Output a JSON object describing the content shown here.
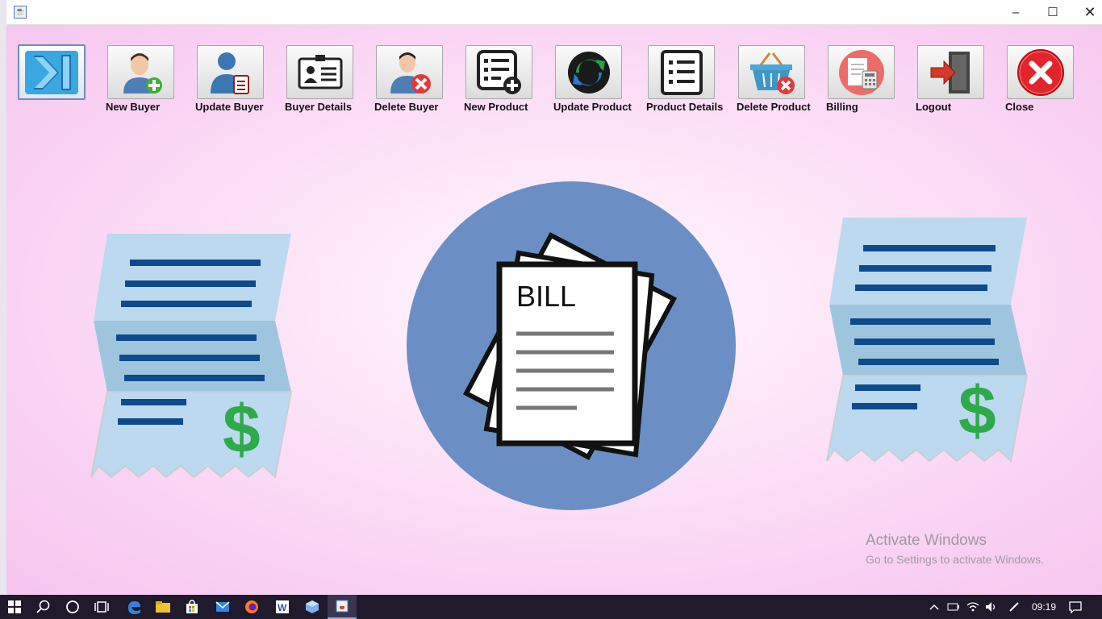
{
  "window": {
    "title_icon": "java-icon",
    "controls": {
      "minimize": "–",
      "maximize": "☐",
      "close": "✕"
    }
  },
  "toolbar": {
    "items": [
      {
        "label": "",
        "icon": "expand-sidebar-icon"
      },
      {
        "label": "New Buyer",
        "icon": "add-user-icon"
      },
      {
        "label": "Update Buyer",
        "icon": "edit-user-icon"
      },
      {
        "label": "Buyer Details",
        "icon": "id-card-icon"
      },
      {
        "label": "Delete Buyer",
        "icon": "delete-user-icon"
      },
      {
        "label": "New Product",
        "icon": "add-list-icon"
      },
      {
        "label": "Update Product",
        "icon": "refresh-icon"
      },
      {
        "label": "Product Details",
        "icon": "list-icon"
      },
      {
        "label": "Delete Product",
        "icon": "delete-basket-icon"
      },
      {
        "label": "Billing",
        "icon": "billing-icon"
      },
      {
        "label": "Logout",
        "icon": "logout-door-icon"
      },
      {
        "label": "Close",
        "icon": "close-circle-icon"
      }
    ]
  },
  "illustration": {
    "bill_text": "BILL",
    "currency_symbol": "$"
  },
  "watermark": {
    "title": "Activate Windows",
    "subtitle": "Go to Settings to activate Windows."
  },
  "taskbar": {
    "apps": [
      "windows-start-icon",
      "search-icon",
      "cortana-icon",
      "task-view-icon",
      "edge-icon",
      "file-explorer-icon",
      "store-icon",
      "mail-icon",
      "firefox-icon",
      "word-icon",
      "box-app-icon",
      "java-app-icon"
    ],
    "time": "09:19"
  },
  "colors": {
    "background": "#f9d0f3",
    "circle": "#6b8fc5",
    "receipt_light": "#bcd9ef",
    "receipt_fold": "#9fc5de",
    "receipt_lines": "#0e4a8c",
    "dollar": "#2eaa4a"
  }
}
